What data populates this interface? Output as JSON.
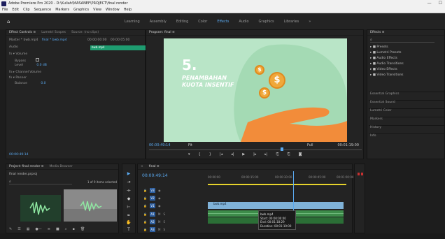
{
  "window": {
    "title": "Adobe Premiere Pro 2020 - D:\\Kuliah\\MASANEF\\PROJECT\\final render",
    "minimize": "—",
    "maximize": "☐"
  },
  "menu": [
    "File",
    "Edit",
    "Clip",
    "Sequence",
    "Markers",
    "Graphics",
    "View",
    "Window",
    "Help"
  ],
  "workspaces": {
    "items": [
      "Learning",
      "Assembly",
      "Editing",
      "Color",
      "Effects",
      "Audio",
      "Graphics",
      "Libraries"
    ],
    "active_index": 4,
    "more": "»"
  },
  "effect_controls": {
    "tabs": [
      "Effect Controls  ≡",
      "Lumetri Scopes",
      "Source: (no clips)"
    ],
    "source": "Master * bwb.mp4",
    "sequence": "final * bwb.mp4",
    "timecode": "00:00:00:00",
    "timecode2": "00:00:05:00",
    "clip_label": "bwb.mp4",
    "section_audio": "Audio",
    "fx_volume": "Volume",
    "bypass": "Bypass",
    "level": "Level",
    "level_value": "0.0 dB",
    "channel_volume": "Channel Volume",
    "panner": "Panner",
    "balance": "Balance",
    "balance_value": "0.0",
    "bottom_tc": "00:00:49:14"
  },
  "program": {
    "tab": "Program: final  ≡",
    "slide_number": "5.",
    "caption_line1": "PENAMBAHAN",
    "caption_line2": "KUOTA INSENTIF",
    "coin_symbol": "$",
    "timecode": "00:00:49:14",
    "fit": "Fit",
    "quality": "Full",
    "duration": "00:01:19:00",
    "controls": [
      "▾",
      "{",
      "}",
      "|◂",
      "◂|",
      "▶",
      "|▸",
      "▸|",
      "⎘",
      "⎘",
      "◙"
    ]
  },
  "effects_panel": {
    "tab": "Effects  ≡",
    "items": [
      "Presets",
      "Lumetri Presets",
      "Audio Effects",
      "Audio Transitions",
      "Video Effects",
      "Video Transitions"
    ],
    "sections": [
      "Essential Graphics",
      "Essential Sound",
      "Lumetri Color",
      "Markers",
      "History",
      "Info"
    ]
  },
  "project": {
    "tabs": [
      "Project: final render  ≡",
      "Media Browser"
    ],
    "file": "final render.prproj",
    "count": "1 of 9 items selected"
  },
  "timeline": {
    "tab": "final  ≡",
    "timecode": "00:00:49:14",
    "ruler": [
      "00:00:00",
      "00:00:15:00",
      "00:00:30:00",
      "00:00:45:00",
      "00:01:00:00"
    ],
    "tracks": [
      {
        "name": "V3"
      },
      {
        "name": "V2"
      },
      {
        "name": "V1"
      },
      {
        "name": "A1"
      },
      {
        "name": "A2"
      },
      {
        "name": "A3"
      }
    ],
    "clip_name": "bwb.mp4",
    "tooltip": {
      "title": "bwb.mp4",
      "start": "Start: 00:00:00:00",
      "end": "End: 00:01:18:29",
      "duration": "Duration: 00:01:19:00"
    }
  }
}
